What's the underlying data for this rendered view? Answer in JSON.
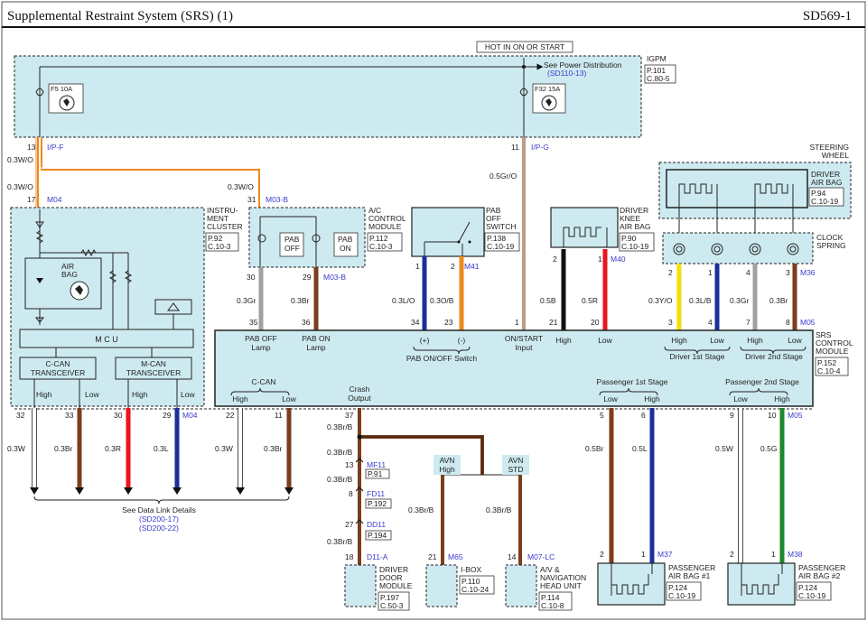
{
  "header": {
    "title": "Supplemental Restraint System (SRS) (1)",
    "code": "SD569-1"
  },
  "hot_label": "HOT IN ON OR START",
  "igpm": {
    "name": "IGPM",
    "page": "P.101",
    "conn": "C.80-5",
    "see_power": "See Power Distribution",
    "see_power_ref": "(SD110-13)",
    "fuse1": "F5 10A",
    "fuse2": "F32 15A"
  },
  "pins": {
    "p13": "13",
    "ipf": "I/P-F",
    "p17": "17",
    "m04": "M04",
    "p11": "11",
    "ipg": "I/P-G",
    "p31": "31",
    "m03b": "M03-B",
    "p30": "30",
    "p29": "29",
    "p29b": "M03-B",
    "p1": "1",
    "p2": "2",
    "m41": "M41",
    "p2k": "2",
    "p1k": "1",
    "m40": "M40",
    "c2": "2",
    "c1": "1",
    "c4": "4",
    "c3": "3",
    "m36": "M36",
    "s35": "35",
    "s36": "36",
    "s34": "34",
    "s23": "23",
    "s1": "1",
    "s21": "21",
    "s20": "20",
    "s3": "3",
    "s4": "4",
    "s7": "7",
    "s8": "8",
    "m05a": "M05",
    "s37": "37",
    "s5": "5",
    "s6": "6",
    "s9": "9",
    "s10": "10",
    "m05b": "M05",
    "b32": "32",
    "b33": "33",
    "b30": "30",
    "b29": "29",
    "bm04": "M04",
    "b22": "22",
    "b11": "11",
    "j13": "13",
    "mf11": "MF11",
    "j8": "8",
    "fd11": "FD11",
    "j27": "27",
    "dd11": "DD11",
    "j18": "18",
    "d11a": "D11-A",
    "j21": "21",
    "m65": "M65",
    "j14": "14",
    "m07lc": "M07-LC",
    "pb2": "2",
    "pb1": "1",
    "m37": "M37",
    "pc2": "2",
    "pc1": "1",
    "m38": "M38"
  },
  "wires": {
    "w1": "0.3W/O",
    "w2": "0.3W/O",
    "w3": "0.3W/O",
    "w4": "0.5Gr/O",
    "w5": "0.3Gr",
    "w6": "0.3Br",
    "w7": "0.3L/O",
    "w8": "0.3O/B",
    "w9": "0.5B",
    "w10": "0.5R",
    "w11": "0.3Y/O",
    "w12": "0.3L/B",
    "w13": "0.3Gr",
    "w14": "0.3Br",
    "w15": "0.3W",
    "w16": "0.3Br",
    "w17": "0.3R",
    "w18": "0.3L",
    "w19": "0.3W",
    "w20": "0.3Br",
    "w21": "0.3Br/B",
    "w22": "0.3Br/B",
    "w23": "0.3Br/B",
    "w24": "0.3Br/B",
    "w25": "0.3Br/B",
    "w26": "0.3Br/B",
    "w27": "0.5Br",
    "w28": "0.5L",
    "w29": "0.5W",
    "w30": "0.5G"
  },
  "cluster": {
    "name1": "INSTRU-",
    "name2": "MENT",
    "name3": "CLUSTER",
    "page": "P.92",
    "conn": "C.10-3",
    "airbag1": "AIR",
    "airbag2": "BAG",
    "mcu": "M C U",
    "ccan1": "C-CAN",
    "ccan2": "TRANSCEIVER",
    "mcan1": "M-CAN",
    "mcan2": "TRANSCEIVER",
    "h1": "High",
    "l1": "Low",
    "h2": "High",
    "l2": "Low"
  },
  "ac": {
    "name1": "A/C",
    "name2": "CONTROL",
    "name3": "MODULE",
    "page": "P.112",
    "conn": "C.10-3",
    "pab": "PAB",
    "off": "OFF",
    "on": "ON"
  },
  "pab_switch": {
    "name1": "PAB",
    "name2": "OFF",
    "name3": "SWITCH",
    "page": "P.138",
    "conn": "C.10-19"
  },
  "knee": {
    "name1": "DRIVER",
    "name2": "KNEE",
    "name3": "AIR BAG",
    "page": "P.90",
    "conn": "C.10-19"
  },
  "steering": {
    "name1": "STEERING",
    "name2": "WHEEL",
    "dab1": "DRIVER",
    "dab2": "AIR BAG",
    "page": "P.94",
    "conn": "C.10-19",
    "clock1": "CLOCK",
    "clock2": "SPRING"
  },
  "srs": {
    "name1": "SRS",
    "name2": "CONTROL",
    "name3": "MODULE",
    "page": "P.152",
    "conn": "C.10-4",
    "paboff1": "PAB OFF",
    "paboff2": "Lamp",
    "pabon1": "PAB ON",
    "pabon2": "Lamp",
    "plus": "(+)",
    "minus": "(-)",
    "pabsw": "PAB ON/OFF Switch",
    "onstart1": "ON/START",
    "onstart2": "Input",
    "high": "High",
    "low": "Low",
    "d1h": "High",
    "d1l": "Low",
    "d1": "Driver 1st Stage",
    "d2h": "High",
    "d2l": "Low",
    "d2": "Driver 2nd Stage",
    "ccan": "C-CAN",
    "ch": "High",
    "cl": "Low",
    "crash1": "Crash",
    "crash2": "Output",
    "p1": "Passenger 1st Stage",
    "p1l": "Low",
    "p1h": "High",
    "p2": "Passenger 2nd Stage",
    "p2l": "Low",
    "p2h": "High"
  },
  "datalink": {
    "text": "See Data Link Details",
    "ref1": "(SD200-17)",
    "ref2": "(SD200-22)"
  },
  "avn": {
    "high1": "AVN",
    "high2": "High",
    "std1": "AVN",
    "std2": "STD"
  },
  "connrefs": {
    "mf11": "P.91",
    "fd11": "P.192",
    "dd11": "P.194"
  },
  "bottom": {
    "door1": "DRIVER",
    "door2": "DOOR",
    "door3": "MODULE",
    "door_page": "P.197",
    "door_conn": "C.50-3",
    "ibox": "I-BOX",
    "ibox_page": "P.110",
    "ibox_conn": "C.10-24",
    "av1": "A/V &",
    "av2": "NAVIGATION",
    "av3": "HEAD UNIT",
    "av_page": "P.114",
    "av_conn": "C.10-8",
    "pab1_1": "PASSENGER",
    "pab1_2": "AIR BAG #1",
    "pab1_page": "P.124",
    "pab1_conn": "C.10-19",
    "pab2_1": "PASSENGER",
    "pab2_2": "AIR BAG #2",
    "pab2_page": "P.124",
    "pab2_conn": "C.10-19"
  },
  "colors": {
    "component_fill": "#cdeaf0",
    "orange": "#f08a1c",
    "brown": "#7a3e1e",
    "gray": "#a0a0a0",
    "red": "#e8141e",
    "blue": "#1a2f9c",
    "yellow": "#f2e000",
    "green": "#1a8a2a",
    "black": "#111111",
    "pinkish_gray": "#c09b8a"
  }
}
